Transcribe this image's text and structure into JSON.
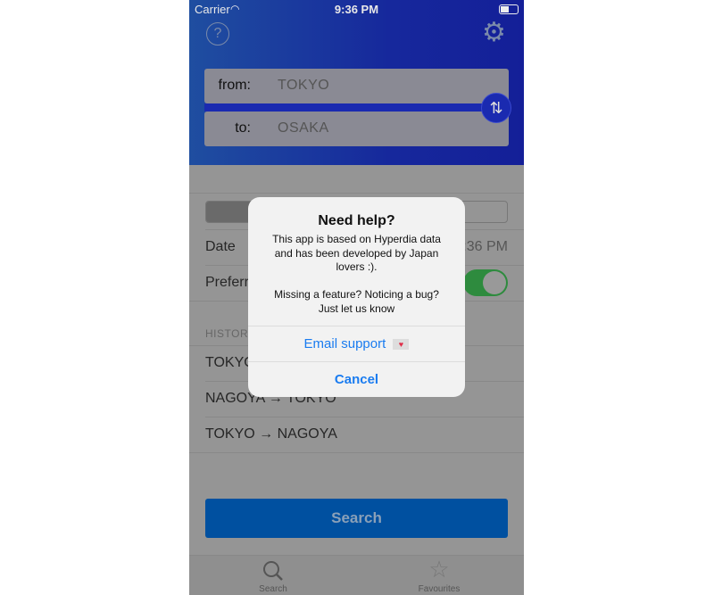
{
  "status_bar": {
    "carrier": "Carrier",
    "time": "9:36 PM"
  },
  "header": {
    "from_label": "from:",
    "from_value": "TOKYO",
    "to_label": "to:",
    "to_value": "OSAKA",
    "swap_glyph": "⇅"
  },
  "form": {
    "date_label": "Date",
    "date_value": "9:36 PM",
    "preferred_label": "Preferred",
    "preferred_toggle": true
  },
  "history": {
    "header": "HISTORY",
    "items": [
      "TOKYO → OSAKA",
      "NAGOYA → TOKYO",
      "TOKYO → NAGOYA"
    ]
  },
  "search_button": "Search",
  "tabs": [
    {
      "label": "Search",
      "icon": "magnifier-icon"
    },
    {
      "label": "Favourites",
      "icon": "star-icon"
    }
  ],
  "dialog": {
    "title": "Need help?",
    "message": "This app is based on Hyperdia data\nand has been developed by Japan\nlovers :).\n\nMissing a feature? Noticing a bug?\nJust let us know",
    "email_button": "Email support",
    "cancel_button": "Cancel"
  },
  "colors": {
    "accent": "#1a7cf0",
    "toggle_on": "#2e8b3e",
    "search_button": "#0050a0"
  }
}
